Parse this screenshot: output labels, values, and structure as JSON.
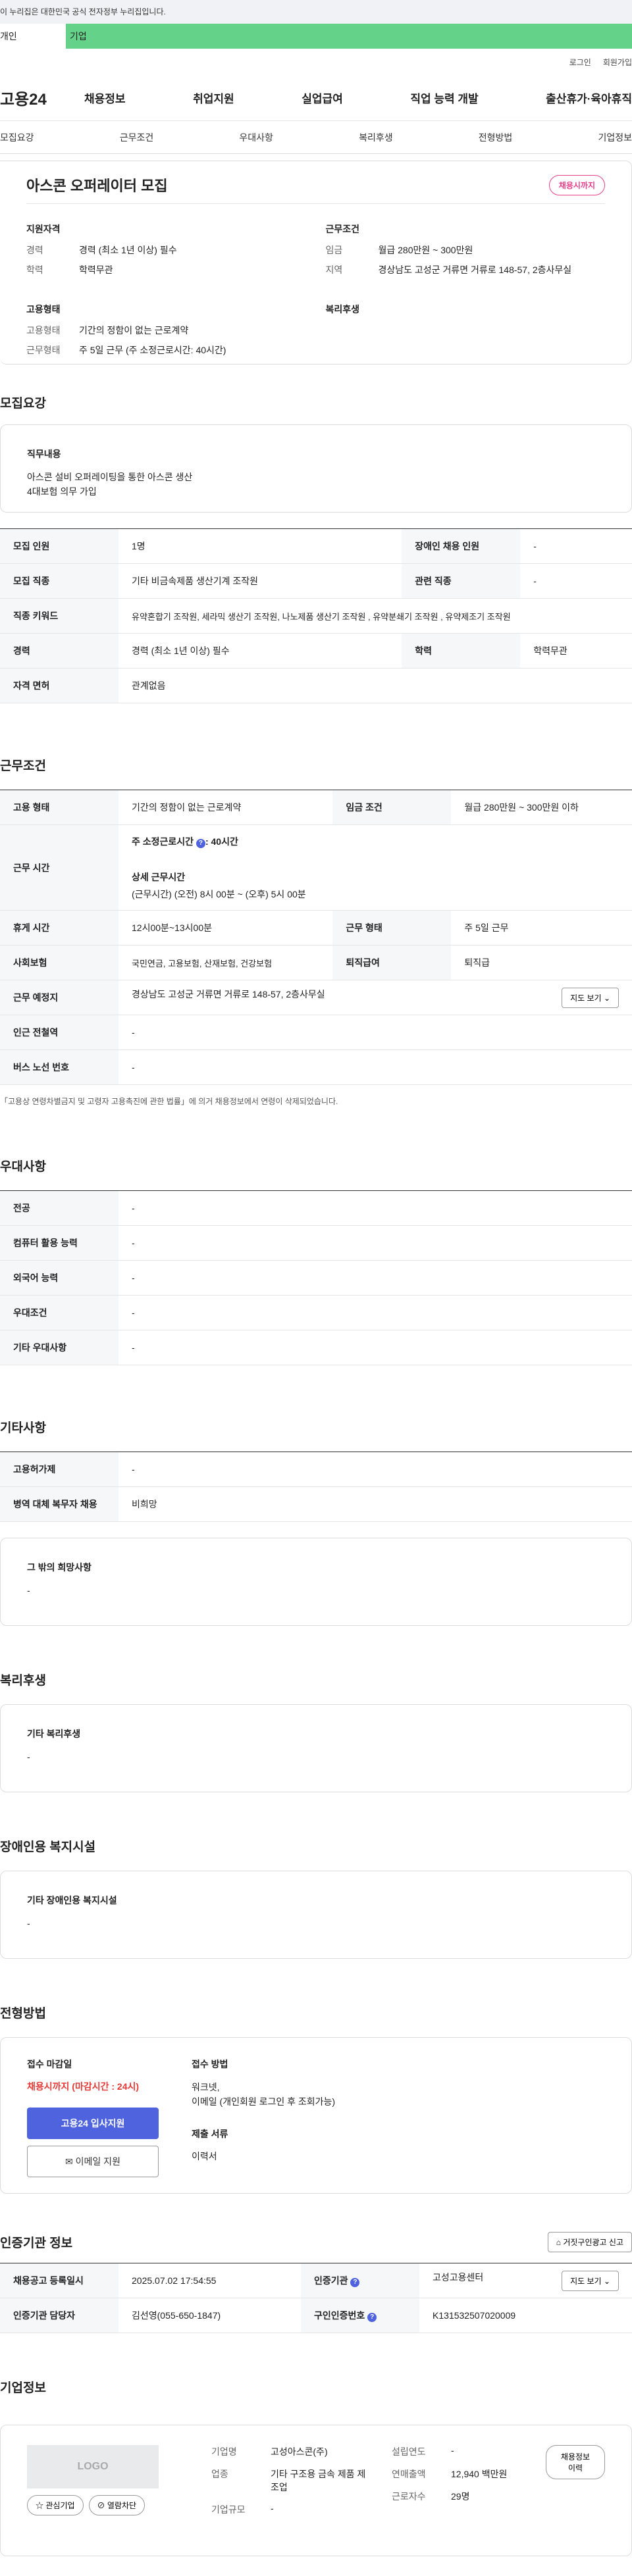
{
  "gov_banner": "이 누리집은 대한민국 공식 전자정부 누리집입니다.",
  "tabs": [
    "개인",
    "기업"
  ],
  "util": [
    "로그인",
    "회원가입"
  ],
  "logo": "고용24",
  "gnb": [
    "채용정보",
    "취업지원",
    "실업급여",
    "직업 능력 개발",
    "출산휴가·육아휴직"
  ],
  "subnav": [
    "모집요강",
    "근무조건",
    "우대사항",
    "복리후생",
    "전형방법",
    "기업정보"
  ],
  "job": {
    "title": "아스콘 오퍼레이터 모집",
    "badge": "채용시까지",
    "qual_title": "지원자격",
    "qual": [
      [
        "경력",
        "경력 (최소 1년 이상) 필수"
      ],
      [
        "학력",
        "학력무관"
      ]
    ],
    "emp_title": "고용형태",
    "emp": [
      [
        "고용형태",
        "기간의 정함이 없는 근로계약"
      ],
      [
        "근무형태",
        "주 5일 근무 (주 소정근로시간: 40시간)"
      ]
    ],
    "cond_title": "근무조건",
    "cond": [
      [
        "임금",
        "월급 280만원 ~ 300만원"
      ],
      [
        "지역",
        "경상남도 고성군 거류면 거류로 148-57, 2층사무실"
      ]
    ],
    "welfare_title": "복리후생"
  },
  "recruit": {
    "title": "모집요강",
    "duty_title": "직무내용",
    "duty_lines": [
      "아스콘 설비 오퍼레이팅을 통한 아스콘 생산",
      "4대보험 의무 가입"
    ],
    "rows": [
      [
        "모집 인원",
        "1명",
        "장애인 채용 인원",
        "-"
      ],
      [
        "모집 직종",
        "기타 비금속제품 생산기계 조작원",
        "관련 직종",
        "-"
      ],
      [
        "직종 키워드",
        "유약혼합기 조작원, 세라믹 생산기 조작원, 나노제품 생산기 조작원 , 유약분쇄기 조작원 , 유약제조기 조작원"
      ],
      [
        "경력",
        "경력 (최소 1년 이상) 필수",
        "학력",
        "학력무관"
      ],
      [
        "자격 면허",
        "관계없음"
      ]
    ]
  },
  "work": {
    "title": "근무조건",
    "emp_type_label": "고용 형태",
    "emp_type": "기간의 정함이 없는 근로계약",
    "wage_label": "임금 조건",
    "wage": "월급 280만원 ~ 300만원 이하",
    "hours_label": "근무 시간",
    "hours_main": "주 소정근로시간",
    "hours_main_val": ": 40시간",
    "hours_detail_title": "상세 근무시간",
    "hours_detail": "(근무시간) (오전) 8시 00분 ~ (오후) 5시 00분",
    "break_label": "휴게 시간",
    "break": "12시00분~13시00분",
    "form_label": "근무 형태",
    "form": "주 5일 근무",
    "ins_label": "사회보험",
    "ins": "국민연금, 고용보험, 산재보험, 건강보험",
    "sev_label": "퇴직급여",
    "sev": "퇴직급",
    "place_label": "근무 예정지",
    "place": "경상남도 고성군 거류면 거류로 148-57, 2층사무실",
    "map_btn": "지도 보기",
    "subway_label": "인근 전철역",
    "subway": "-",
    "bus_label": "버스 노선 번호",
    "bus": "-",
    "note": "「고용상 연령차별금지 및 고령자 고용촉진에 관한 법률」에 의거 채용정보에서 연령이 삭제되었습니다."
  },
  "pref": {
    "title": "우대사항",
    "rows": [
      [
        "전공",
        "-"
      ],
      [
        "컴퓨터 활용 능력",
        "-"
      ],
      [
        "외국어 능력",
        "-"
      ],
      [
        "우대조건",
        "-"
      ],
      [
        "기타 우대사항",
        "-"
      ]
    ]
  },
  "etc": {
    "title": "기타사항",
    "rows": [
      [
        "고용허가제",
        "-"
      ],
      [
        "병역 대체 복무자 채용",
        "비희망"
      ]
    ],
    "wish_title": "그 밖의 희망사항",
    "wish": "-"
  },
  "welfare": {
    "title": "복리후생",
    "box_title": "기타 복리후생",
    "box_val": "-"
  },
  "disabled": {
    "title": "장애인용 복지시설",
    "box_title": "기타 장애인용 복지시설",
    "box_val": "-"
  },
  "apply": {
    "title": "전형방법",
    "deadline_title": "접수 마감일",
    "deadline": "채용시까지 (마감시간 : 24시)",
    "btn_apply": "고용24 입사지원",
    "btn_email": "이메일 지원",
    "method_title": "접수 방법",
    "method_lines": [
      "워크넷,",
      "이메일 (개인회원 로그인 후 조회가능)"
    ],
    "docs_title": "제출 서류",
    "docs": "이력서"
  },
  "cert": {
    "title": "인증기관 정보",
    "report_btn": "거짓구인광고 신고",
    "reg_label": "채용공고 등록일시",
    "reg": "2025.07.02 17:54:55",
    "org_label": "인증기관",
    "org": "고성고용센터",
    "map_btn": "지도 보기",
    "mgr_label": "인증기관 담당자",
    "mgr": "김선영(055-650-1847)",
    "id_label": "구인인증번호",
    "id": "K131532507020009"
  },
  "company": {
    "title": "기업정보",
    "logo": "LOGO",
    "fav_btn": "관심기업",
    "block_btn": "열람차단",
    "name_label": "기업명",
    "name": "고성아스콘(주)",
    "ind_label": "업종",
    "ind": "기타 구조용 금속 제품 제조업",
    "size_label": "기업규모",
    "size": "-",
    "est_label": "설립연도",
    "est": "-",
    "sales_label": "연매출액",
    "sales": "12,940 백만원",
    "emp_label": "근로자수",
    "emp": "29명",
    "history_btn": "채용정보 이력"
  }
}
